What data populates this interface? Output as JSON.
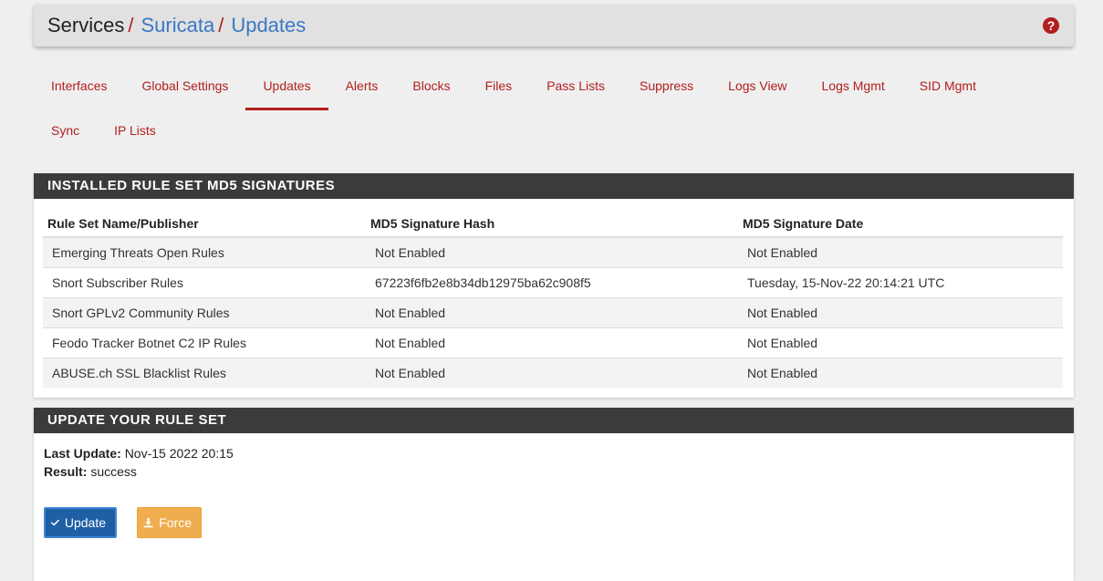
{
  "breadcrumb": {
    "root": "Services",
    "sep": "/",
    "level1": "Suricata",
    "level2": "Updates"
  },
  "tabs": [
    {
      "label": "Interfaces"
    },
    {
      "label": "Global Settings"
    },
    {
      "label": "Updates"
    },
    {
      "label": "Alerts"
    },
    {
      "label": "Blocks"
    },
    {
      "label": "Files"
    },
    {
      "label": "Pass Lists"
    },
    {
      "label": "Suppress"
    },
    {
      "label": "Logs View"
    },
    {
      "label": "Logs Mgmt"
    },
    {
      "label": "SID Mgmt"
    },
    {
      "label": "Sync"
    },
    {
      "label": "IP Lists"
    }
  ],
  "active_tab": "Updates",
  "signatures_panel": {
    "title": "INSTALLED RULE SET MD5 SIGNATURES",
    "columns": [
      "Rule Set Name/Publisher",
      "MD5 Signature Hash",
      "MD5 Signature Date"
    ],
    "rows": [
      [
        "Emerging Threats Open Rules",
        "Not Enabled",
        "Not Enabled"
      ],
      [
        "Snort Subscriber Rules",
        "67223f6fb2e8b34db12975ba62c908f5",
        "Tuesday, 15-Nov-22 20:14:21 UTC"
      ],
      [
        "Snort GPLv2 Community Rules",
        "Not Enabled",
        "Not Enabled"
      ],
      [
        "Feodo Tracker Botnet C2 IP Rules",
        "Not Enabled",
        "Not Enabled"
      ],
      [
        "ABUSE.ch SSL Blacklist Rules",
        "Not Enabled",
        "Not Enabled"
      ]
    ]
  },
  "update_panel": {
    "title": "UPDATE YOUR RULE SET",
    "last_update_label": "Last Update:",
    "last_update_value": "Nov-15 2022 20:15",
    "result_label": "Result:",
    "result_value": "success",
    "update_button": "Update",
    "force_button": "Force"
  },
  "icons": {
    "help": "question-circle-icon",
    "update": "check-icon",
    "force": "download-icon"
  },
  "colors": {
    "accent": "#b21e1e",
    "link": "#3c78c4",
    "panel_heading": "#3b3b3b",
    "update_button": "#1f5fa6",
    "force_button": "#f0ad4e"
  }
}
